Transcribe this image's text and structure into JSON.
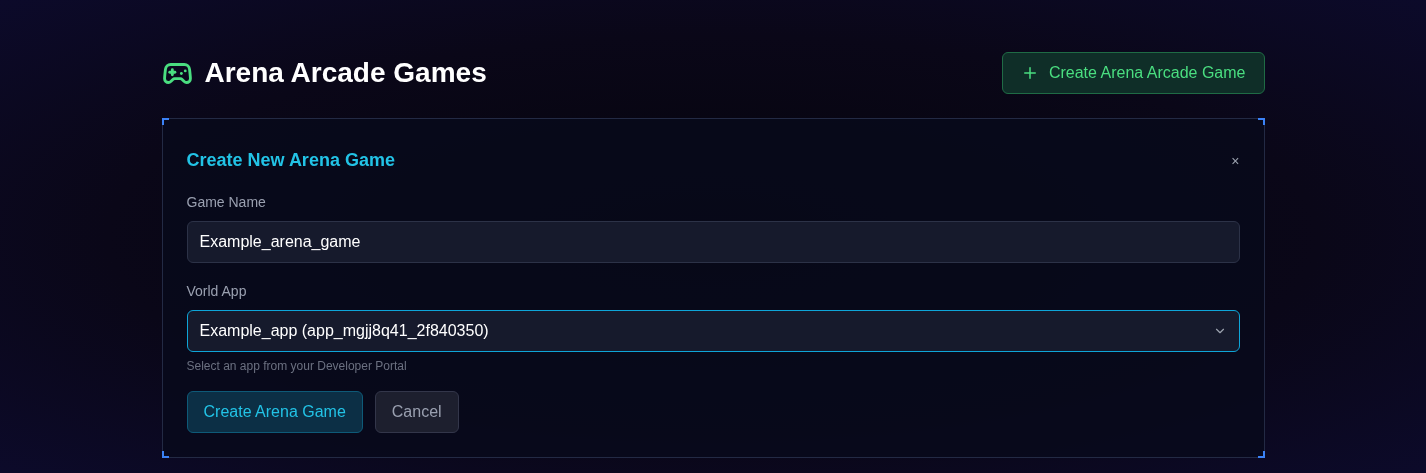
{
  "header": {
    "title": "Arena Arcade Games",
    "create_button": "Create Arena Arcade Game"
  },
  "dialog": {
    "title": "Create New Arena Game",
    "close": "×",
    "fields": [
      {
        "kind": "text",
        "label": "Game Name",
        "value": "Example_arena_game",
        "focused": false
      },
      {
        "kind": "select",
        "label": "Vorld App",
        "value": "Example_app (app_mgjj8q41_2f840350)",
        "focused": true,
        "hint": "Select an app from your Developer Portal"
      }
    ],
    "buttons": [
      {
        "kind": "primary",
        "label": "Create Arena Game"
      },
      {
        "kind": "secondary",
        "label": "Cancel"
      }
    ]
  }
}
